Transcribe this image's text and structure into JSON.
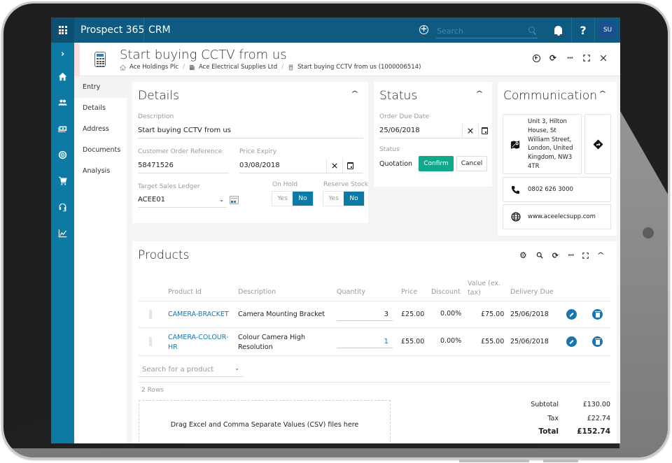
{
  "app": {
    "brand": "Prospect 365",
    "module": "CRM",
    "search_placeholder": "Search",
    "user_initials": "SU",
    "help_label": "?"
  },
  "rail": {
    "expand_label": "›",
    "items": [
      {
        "icon": "home-icon"
      },
      {
        "icon": "people-icon"
      },
      {
        "icon": "money-icon"
      },
      {
        "icon": "target-icon"
      },
      {
        "icon": "cart-icon"
      },
      {
        "icon": "headset-icon"
      },
      {
        "icon": "chart-icon"
      }
    ]
  },
  "record": {
    "title": "Start buying CCTV from us",
    "breadcrumb": [
      {
        "icon": "house-icon",
        "label": "Ace Holdings Plc"
      },
      {
        "icon": "building-icon",
        "label": "Ace Electrical Supplies Ltd"
      },
      {
        "icon": "calculator-icon",
        "label": "Start buying CCTV from us (1000006514)"
      }
    ],
    "actions": [
      "add-icon",
      "refresh-icon",
      "more-icon",
      "expand-icon",
      "close-icon"
    ]
  },
  "subnav": {
    "items": [
      {
        "label": "Entry",
        "active": true
      },
      {
        "label": "Details",
        "active": false
      },
      {
        "label": "Address",
        "active": false
      },
      {
        "label": "Documents",
        "active": false
      },
      {
        "label": "Analysis",
        "active": false
      }
    ]
  },
  "details": {
    "title": "Details",
    "description_label": "Description",
    "description_value": "Start buying CCTV from us",
    "cust_ref_label": "Customer Order Reference",
    "cust_ref_value": "58471526",
    "price_expiry_label": "Price Expiry",
    "price_expiry_value": "03/08/2018",
    "ledger_label": "Target Sales Ledger",
    "ledger_value": "ACEE01",
    "on_hold_label": "On Hold",
    "reserve_stock_label": "Reserve Stock",
    "yes_label": "Yes",
    "no_label": "No",
    "on_hold_selected": "No",
    "reserve_stock_selected": "No"
  },
  "status": {
    "title": "Status",
    "order_due_label": "Order Due Date",
    "order_due_value": "25/06/2018",
    "status_label": "Status",
    "status_value": "Quotation",
    "confirm_label": "Confirm",
    "cancel_label": "Cancel"
  },
  "communication": {
    "title": "Communication",
    "address_lines": [
      "Unit 3, Hilton",
      "House, St",
      "William Street,",
      "London, United",
      "Kingdom, NW3",
      "4TR"
    ],
    "phone": "0802 626 3000",
    "website": "www.aceelecsupp.com"
  },
  "products": {
    "title": "Products",
    "columns": {
      "product_id": "Product Id",
      "description": "Description",
      "quantity": "Quantity",
      "price": "Price",
      "discount": "Discount",
      "value_line1": "Value (ex.",
      "value_line2": "tax)",
      "delivery_due": "Delivery Due"
    },
    "rows": [
      {
        "id_line1": "CAMERA-BRACKET",
        "id_line2": "",
        "desc_line1": "Camera Mounting Bracket",
        "desc_line2": "",
        "quantity": "3",
        "price": "£25.00",
        "discount": "0.00%",
        "value": "£75.00",
        "delivery_due": "25/06/2018"
      },
      {
        "id_line1": "CAMERA-COLOUR-",
        "id_line2": "HR",
        "desc_line1": "Colour Camera High",
        "desc_line2": "Resolution",
        "quantity": "1",
        "price": "£55.00",
        "discount": "0.00%",
        "value": "£55.00",
        "delivery_due": "25/06/2018"
      }
    ],
    "search_placeholder": "Search for a product",
    "row_count": "2 Rows",
    "dropzone_text": "Drag Excel and Comma Separate Values (CSV) files here",
    "subtotal_label": "Subtotal",
    "subtotal_value": "£130.00",
    "tax_label": "Tax",
    "tax_value": "£22.74",
    "total_label": "Total",
    "total_value": "£152.74"
  },
  "colors": {
    "topbar": "#0f5a80",
    "rail": "#0c7aa3",
    "accent_link": "#1a77ad",
    "confirm": "#11a889",
    "avatar": "#1a4f91"
  }
}
